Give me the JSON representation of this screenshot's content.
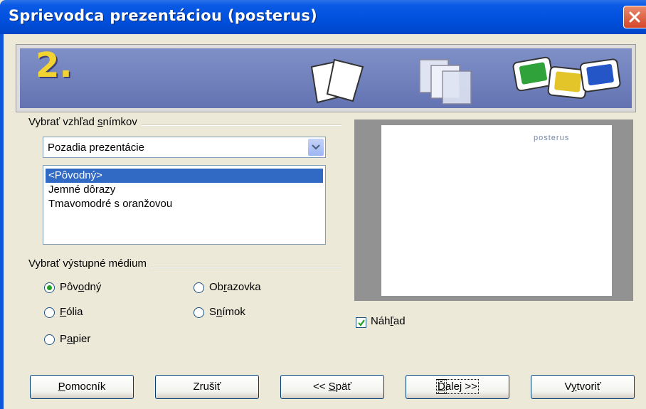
{
  "window": {
    "title": "Sprievodca prezentáciou (posterus)",
    "close_icon": "close-icon"
  },
  "banner": {
    "step": "2."
  },
  "design_group": {
    "label_before": "Vybrať vzhľad ",
    "label_accel": "s",
    "label_after": "nímkov",
    "category_selected": "Pozadia prezentácie",
    "items": [
      {
        "label": "<Pôvodný>",
        "selected": true
      },
      {
        "label": "Jemné dôrazy",
        "selected": false
      },
      {
        "label": "Tmavomodré s oranžovou",
        "selected": false
      }
    ]
  },
  "output_group": {
    "label": "Vybrať výstupné médium",
    "options": [
      {
        "pre": "Pôv",
        "accel": "o",
        "post": "dný",
        "checked": true
      },
      {
        "pre": "Ob",
        "accel": "r",
        "post": "azovka",
        "checked": false
      },
      {
        "pre": "",
        "accel": "F",
        "post": "ólia",
        "checked": false
      },
      {
        "pre": "S",
        "accel": "n",
        "post": "ímok",
        "checked": false
      },
      {
        "pre": "P",
        "accel": "a",
        "post": "pier",
        "checked": false
      }
    ]
  },
  "preview": {
    "logo_text": "posterus",
    "checkbox": {
      "pre": "Náh",
      "accel": "ľ",
      "post": "ad",
      "checked": true
    }
  },
  "buttons": {
    "help": {
      "pre": "",
      "accel": "P",
      "post": "omocník"
    },
    "cancel": {
      "label": "Zrušiť"
    },
    "back": {
      "pre": "<< ",
      "accel": "S",
      "post": "päť"
    },
    "next": {
      "pre": "",
      "accel": "Ď",
      "post": "alej >>"
    },
    "create": {
      "pre": "V",
      "accel": "y",
      "post": "tvoriť"
    }
  },
  "colors": {
    "titlebar": "#0050dd",
    "selection": "#316ac5",
    "banner": "#7383bf",
    "step_number": "#f2d331"
  }
}
